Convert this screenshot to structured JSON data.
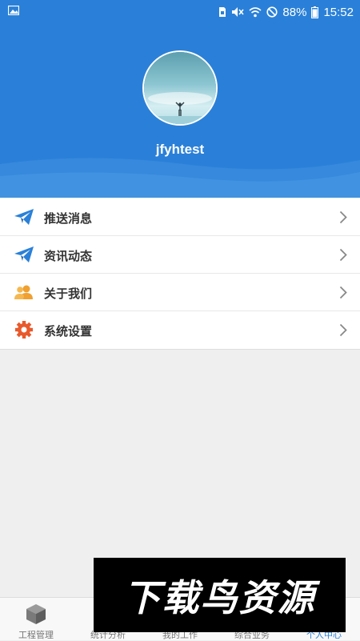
{
  "status_bar": {
    "battery_percent": "88%",
    "time": "15:52"
  },
  "profile": {
    "username": "jfyhtest"
  },
  "menu": {
    "items": [
      {
        "label": "推送消息",
        "icon": "paper-plane-icon",
        "color": "#2a80d8"
      },
      {
        "label": "资讯动态",
        "icon": "paper-plane-icon",
        "color": "#2a80d8"
      },
      {
        "label": "关于我们",
        "icon": "users-icon",
        "color": "#f0a030"
      },
      {
        "label": "系统设置",
        "icon": "gear-icon",
        "color": "#e85a2c"
      }
    ]
  },
  "tabbar": {
    "tabs": [
      {
        "label": "工程管理",
        "icon": "cube-icon",
        "active": false
      },
      {
        "label": "统计分析",
        "icon": "chart-icon",
        "active": false
      },
      {
        "label": "我的工作",
        "icon": "work-icon",
        "active": false
      },
      {
        "label": "综合业务",
        "icon": "business-icon",
        "active": false
      },
      {
        "label": "个人中心",
        "icon": "person-icon",
        "active": true
      }
    ]
  },
  "watermark": {
    "text": "下载鸟资源"
  },
  "colors": {
    "header_blue": "#2a80d8",
    "page_bg": "#efefef",
    "active_tab": "#2a80d8"
  }
}
